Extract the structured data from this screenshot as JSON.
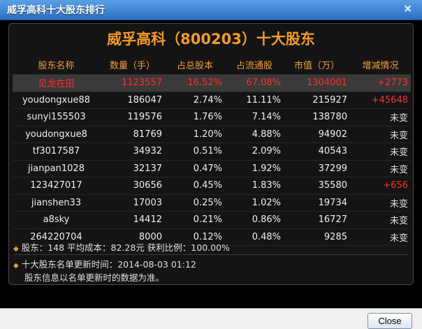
{
  "window": {
    "title": "威孚高科十大股东排行",
    "close_icon": "×"
  },
  "panel": {
    "heading": "威孚高科（800203）十大股东",
    "columns": [
      "股东名称",
      "数量（手）",
      "占总股本",
      "占流通股",
      "市值（万）",
      "增减情况"
    ],
    "rows": [
      {
        "name": "见龙在田",
        "qty": "1123557",
        "total_pct": "16.52%",
        "float_pct": "67.08%",
        "market_value": "1304001",
        "change": "+2773",
        "highlight": true
      },
      {
        "name": "youdongxue88",
        "qty": "186047",
        "total_pct": "2.74%",
        "float_pct": "11.11%",
        "market_value": "215927",
        "change": "+45648"
      },
      {
        "name": "sunyi155503",
        "qty": "119576",
        "total_pct": "1.76%",
        "float_pct": "7.14%",
        "market_value": "138780",
        "change": "未变"
      },
      {
        "name": "youdongxue8",
        "qty": "81769",
        "total_pct": "1.20%",
        "float_pct": "4.88%",
        "market_value": "94902",
        "change": "未变"
      },
      {
        "name": "tf3017587",
        "qty": "34932",
        "total_pct": "0.51%",
        "float_pct": "2.09%",
        "market_value": "40543",
        "change": "未变"
      },
      {
        "name": "jianpan1028",
        "qty": "32137",
        "total_pct": "0.47%",
        "float_pct": "1.92%",
        "market_value": "37299",
        "change": "未变"
      },
      {
        "name": "123427017",
        "qty": "30656",
        "total_pct": "0.45%",
        "float_pct": "1.83%",
        "market_value": "35580",
        "change": "+656"
      },
      {
        "name": "jianshen33",
        "qty": "17003",
        "total_pct": "0.25%",
        "float_pct": "1.02%",
        "market_value": "19734",
        "change": "未变"
      },
      {
        "name": "a8sky",
        "qty": "14412",
        "total_pct": "0.21%",
        "float_pct": "0.86%",
        "market_value": "16727",
        "change": "未变"
      },
      {
        "name": "264220704",
        "qty": "8000",
        "total_pct": "0.12%",
        "float_pct": "0.48%",
        "market_value": "9285",
        "change": "未变"
      }
    ],
    "summary": "股东：148   平均成本：82.28元   获利比例：100.00%",
    "note_line1": "十大股东名单更新时间：2014-08-03 01:12",
    "note_line2": "股东信息以名单更新时的数据为准。"
  },
  "footer": {
    "close_label": "Close"
  },
  "colors": {
    "accent_orange": "#f39a2c",
    "increase_red": "#ff3030",
    "titlebar_blue": "#2a6fc4"
  }
}
